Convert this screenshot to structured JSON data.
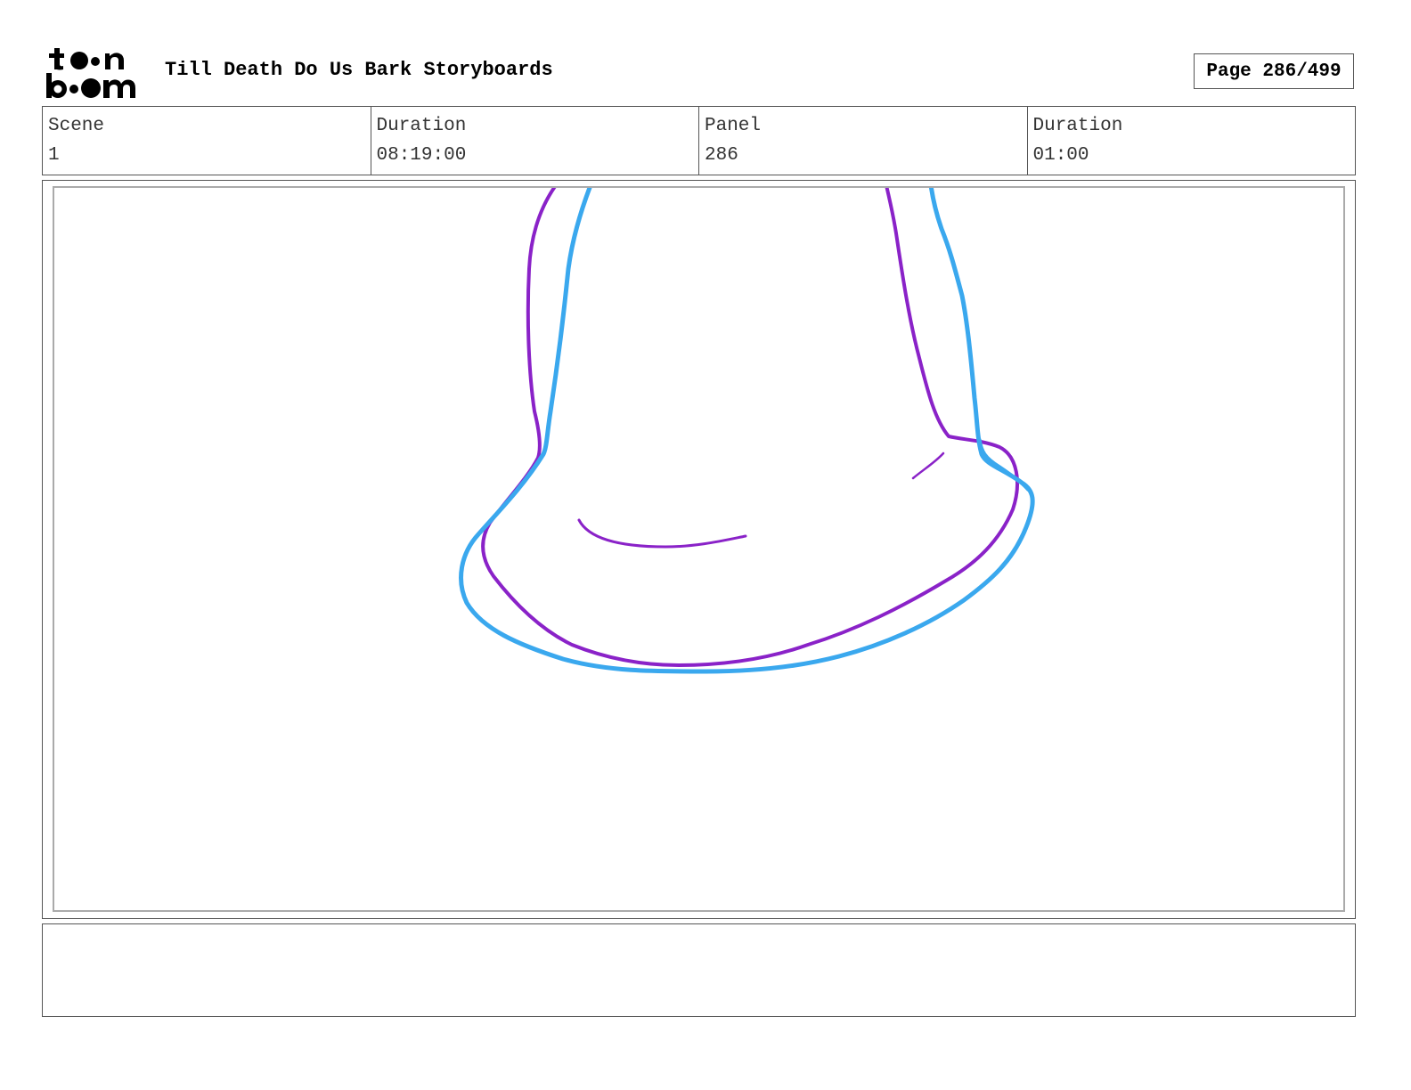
{
  "header": {
    "logo_icon": "toonboom-logo-icon",
    "title": "Till Death Do Us Bark Storyboards",
    "page_label": "Page 286/499"
  },
  "info": {
    "scene_label": "Scene",
    "scene_value": "1",
    "scene_duration_label": "Duration",
    "scene_duration_value": "08:19:00",
    "panel_label": "Panel",
    "panel_value": "286",
    "panel_duration_label": "Duration",
    "panel_duration_value": "01:00"
  },
  "sketch": {
    "rough_color": "#8a22c8",
    "clean_color": "#3aa8ee"
  },
  "notes": {
    "text": ""
  }
}
